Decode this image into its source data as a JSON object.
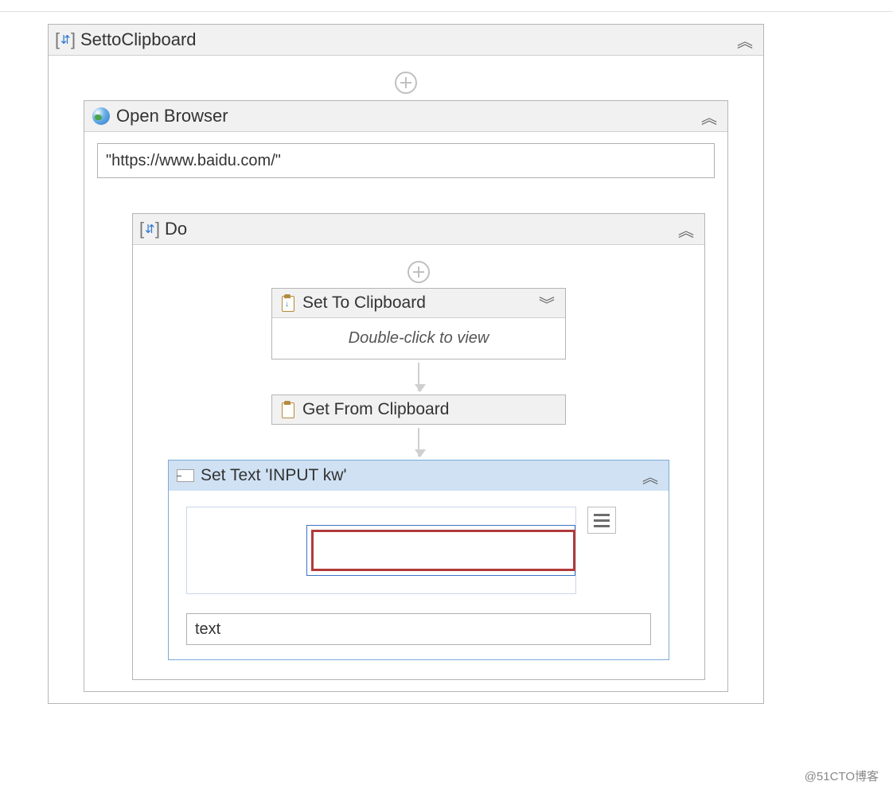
{
  "root": {
    "title": "SettoClipboard"
  },
  "open_browser": {
    "title": "Open Browser",
    "url": "\"https://www.baidu.com/\""
  },
  "do": {
    "title": "Do"
  },
  "set_to_clipboard": {
    "title": "Set To Clipboard",
    "hint": "Double-click to view"
  },
  "get_from_clipboard": {
    "title": "Get From Clipboard"
  },
  "set_text": {
    "title": "Set Text 'INPUT  kw'",
    "value": "text"
  },
  "footer": "@51CTO博客"
}
